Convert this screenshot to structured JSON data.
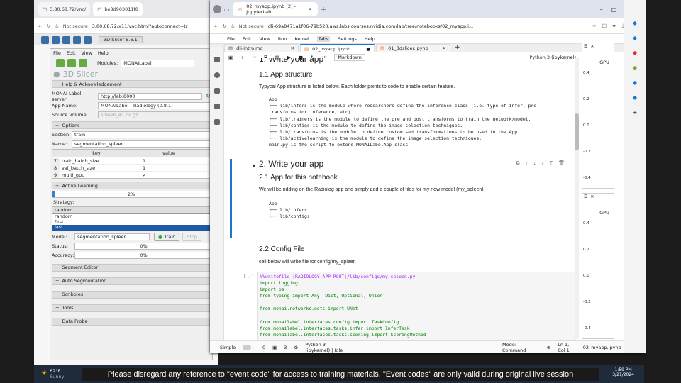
{
  "remote_browser": {
    "tabs": [
      "3.80.68.72/vnc/",
      "be8d903011f8"
    ],
    "url_prefix": "Not secure",
    "url": "3.80.68.72/x11/vnc.html?autoconnect=tr"
  },
  "slicer": {
    "tab_label": "3D Slicer 5.6.1",
    "menu": [
      "File",
      "Edit",
      "View",
      "Help"
    ],
    "modules_label": "Modules:",
    "module": "MONAILabel",
    "logo": "3D Slicer",
    "help_section": "Help & Acknowledgement",
    "server_label": "MONAI Label server:",
    "server": "http://lab:8000",
    "app_label": "App Name:",
    "app": "MONAILabel - Radiology (0.8.1)",
    "source_label": "Source Volume:",
    "source": "spleen_41.nii.gz",
    "options": "Options",
    "section_label": "Section:",
    "section": "train",
    "name_label": "Name:",
    "name": "segmentation_spleen",
    "table_headers": [
      "key",
      "value"
    ],
    "table_rows": [
      {
        "n": "7",
        "key": "train_batch_size",
        "value": "1"
      },
      {
        "n": "8",
        "key": "val_batch_size",
        "value": "1"
      },
      {
        "n": "9",
        "key": "multi_gpu",
        "value": "✓"
      }
    ],
    "active_learning": "Active Learning",
    "progress": "2%",
    "strategy_label": "Strategy:",
    "strategy": "random",
    "strategy_options": [
      "random",
      "first",
      "last"
    ],
    "model_label": "Model:",
    "model": "segmentation_spleen",
    "train_btn": "Train",
    "stop_btn": "Stop",
    "status_label": "Status:",
    "status_val": "0%",
    "accuracy_label": "Accuracy:",
    "accuracy_val": "0%",
    "sections": [
      "Segment Editor",
      "Auto Segmentation",
      "Scribbles",
      "Tools",
      "Data Probe"
    ]
  },
  "jupyter": {
    "tab": "02_myapp.ipynb (2) - JupyterLab",
    "url_prefix": "Not secure",
    "url": "dli-69a8471a1f06-79b520.aws.labs.courses.nvidia.com/lab/tree/notebooks/02_myapp.i...",
    "menu": [
      "File",
      "Edit",
      "View",
      "Run",
      "Kernel",
      "Tabs",
      "Settings",
      "Help"
    ],
    "doc_tabs": [
      "dli-intro.md",
      "02_myapp.ipynb",
      "01_3dslicer.ipynb"
    ],
    "cell_type": "Markdown",
    "kernel": "Python 3 (ipykernel)",
    "h1_top": "1. Write your app",
    "h2_structure": "1.1 App structure",
    "p_structure": "Typycal App structure is listed below. Each folder points to code to enable certain feature.",
    "tree1": "App\n├── lib/infers is the module where researchers define the inference class (i.e. type of infer, pre\ntransforms for inference, etc).\n├── lib/trainers is the module to define the pre and post transforms to train the network/model.\n├── lib/configs is the module to define the image selection techniques.\n├── lib/transforms is the module to define customised transformations to be used in the App.\n├── lib/activelearning is the module to define the image selection techniques.\nmain.py is the script to extend MONAILabelApp class",
    "h1_main": "2. Write your app",
    "h2_app": "2.1 App for this notebook",
    "p_app": "We will be ridding on the Radiolog app and simply add a couple of files for my new model (my_spleen)",
    "tree2": "App\n├── lib/infers\n├── lib/configs",
    "h2_config": "2.2 Config File",
    "p_config": "cell below will write file for config/my_spleen",
    "prompt": "[ ]:",
    "code_lines": [
      "%%writefile {RADIOLOGY_APP_ROOT}/lib/configs/my_spleen.py",
      "import logging",
      "import os",
      "from typing import Any, Dict, Optional, Union",
      "",
      "from monai.networks.nets import UNet",
      "",
      "from monailabel.interfaces.config import TaskConfig",
      "from monailabel.interfaces.tasks.infer import InferTask",
      "from monailabel.interfaces.tasks.scoring import ScoringMethod"
    ],
    "status": {
      "mode": "Simple",
      "n1": "0",
      "n2": "3",
      "kernel": "Python 3 (ipykernel) | Idle",
      "cmd": "Mode: Command",
      "pos": "Ln 1, Col 1",
      "file": "02_myapp.ipynb",
      "right": "1"
    }
  },
  "gpu_panels": {
    "label": "GPU",
    "ticks": [
      "0.4",
      "0.2",
      "0.0",
      "-0.2",
      "-0.4"
    ]
  },
  "taskbar": {
    "weather_temp": "62°F",
    "weather": "Sunny",
    "time": "1:59 PM",
    "date": "3/21/2024"
  },
  "subtitle": "Please disregard any reference to \"event code\" for access to training materials. \"Event codes\" are only valid during original live session"
}
